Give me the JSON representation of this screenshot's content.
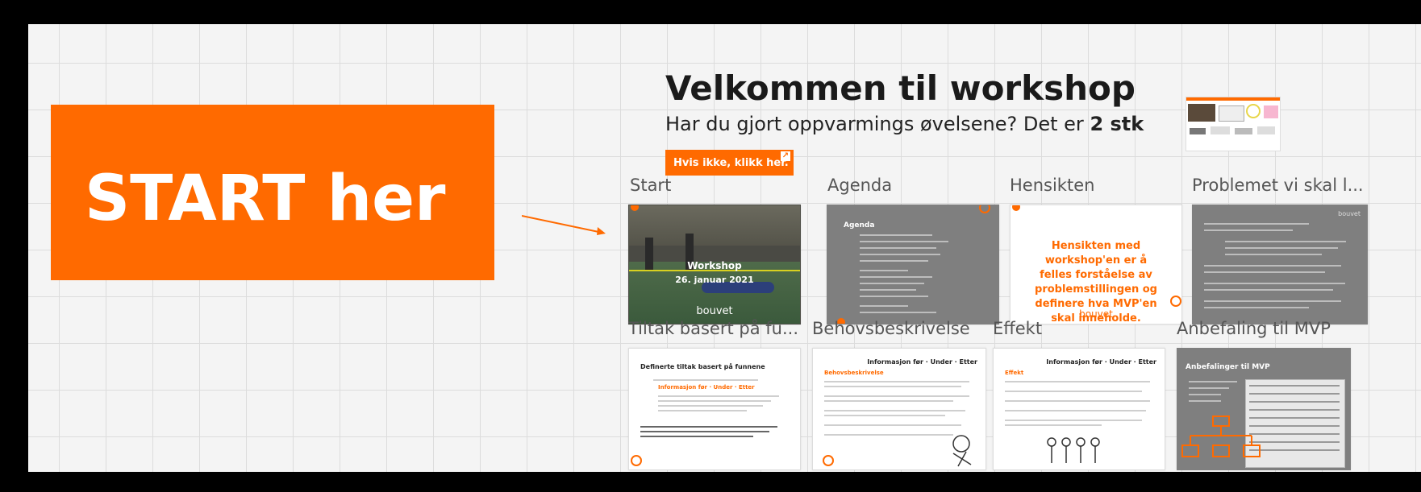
{
  "start": {
    "label": "START her"
  },
  "header": {
    "title": "Velkommen til workshop",
    "subtitle_prefix": "Har du gjort oppvarmings øvelsene? Det er ",
    "subtitle_bold": "2 stk",
    "cta_label": "Hvis ikke, klikk her."
  },
  "frames": [
    {
      "label": "Start",
      "slide_title": "Workshop",
      "slide_date": "26. januar 2021",
      "slide_brand": "bouvet"
    },
    {
      "label": "Agenda",
      "slide_title": "Agenda"
    },
    {
      "label": "Hensikten",
      "slide_text": "Hensikten med workshop'en er å felles forståelse av problemstillingen og definere hva MVP'en skal inneholde.",
      "slide_brand": "bouvet"
    },
    {
      "label": "Problemet vi skal l...",
      "slide_brand": "bouvet"
    },
    {
      "label": "Tiltak basert på fu...",
      "slide_title": "Definerte tiltak basert på funnene",
      "slide_highlight": "Informasjon før · Under · Etter"
    },
    {
      "label": "Behovsbeskrivelse",
      "slide_title": "Informasjon før · Under · Etter",
      "slide_sub": "Behovsbeskrivelse"
    },
    {
      "label": "Effekt",
      "slide_title": "Informasjon før · Under · Etter",
      "slide_sub": "Effekt"
    },
    {
      "label": "Anbefaling til MVP",
      "slide_title": "Anbefalinger til MVP"
    }
  ],
  "colors": {
    "accent": "#ff6a00",
    "slide_gray": "#7f7f7f",
    "board": "#f4f4f4"
  }
}
